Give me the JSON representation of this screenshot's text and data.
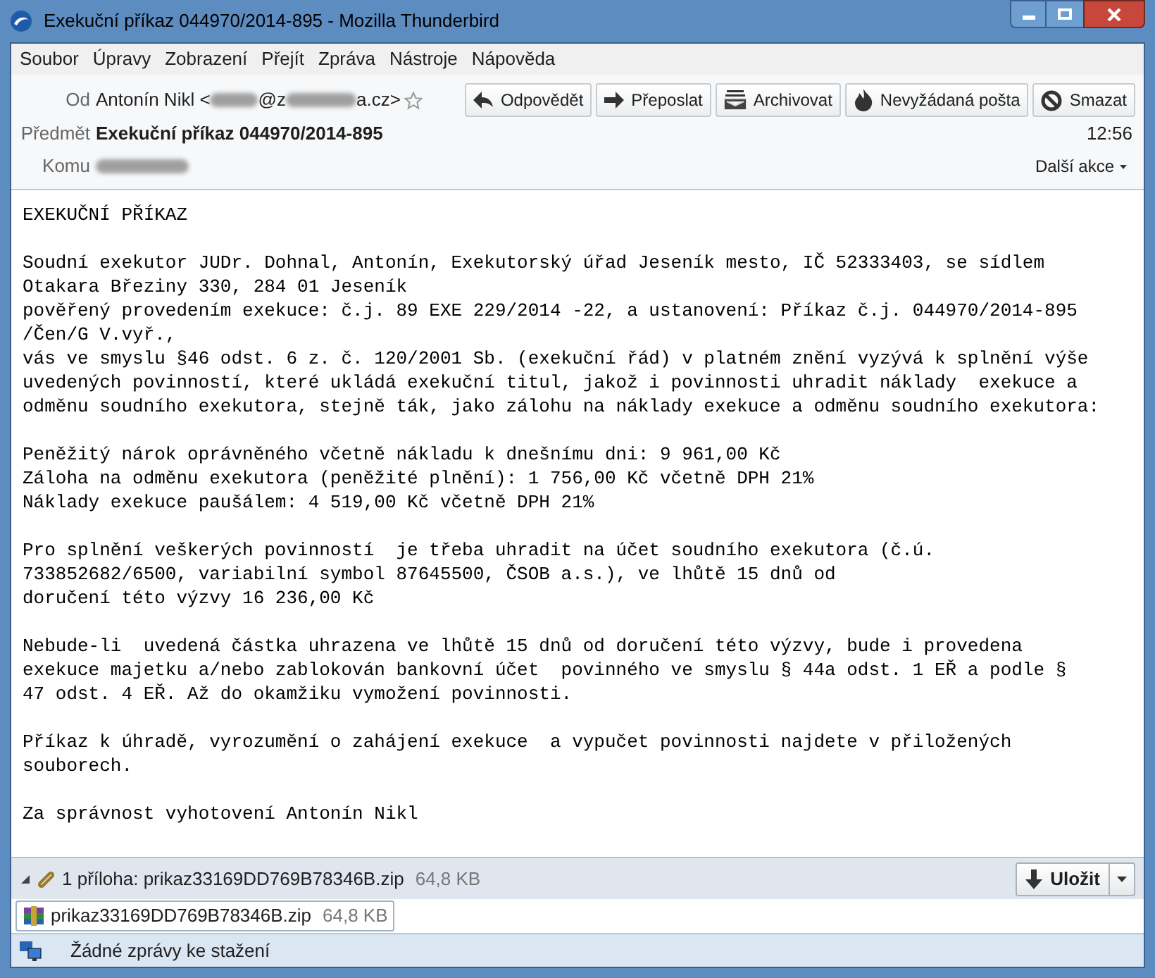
{
  "window": {
    "title": "Exekuční příkaz 044970/2014-895 - Mozilla Thunderbird"
  },
  "menu": [
    {
      "label": "Soubor"
    },
    {
      "label": "Úpravy"
    },
    {
      "label": "Zobrazení"
    },
    {
      "label": "Přejít"
    },
    {
      "label": "Zpráva"
    },
    {
      "label": "Nástroje"
    },
    {
      "label": "Nápověda"
    }
  ],
  "header": {
    "from_label": "Od",
    "from_name": "Antonín Nikl <",
    "from_at": "@z",
    "from_end": "a.cz>",
    "subject_label": "Předmět",
    "subject": "Exekuční příkaz 044970/2014-895",
    "to_label": "Komu",
    "time": "12:56",
    "more_actions": "Další akce"
  },
  "actions": [
    {
      "kind": "reply",
      "label": "Odpovědět"
    },
    {
      "kind": "forward",
      "label": "Přeposlat"
    },
    {
      "kind": "archive",
      "label": "Archivovat"
    },
    {
      "kind": "junk",
      "label": "Nevyžádaná pošta"
    },
    {
      "kind": "delete",
      "label": "Smazat"
    }
  ],
  "body": [
    [
      "EXEKUČNÍ PŘÍKAZ"
    ],
    [
      "Soudní exekutor JUDr. Dohnal, Antonín, Exekutorský úřad Jeseník mesto, IČ 52333403, se sídlem",
      "Otakara Březiny 330, 284 01 Jeseník",
      "pověřený provedením exekuce: č.j. 89 EXE 229/2014 -22, a ustanovení: Příkaz č.j. 044970/2014-895",
      "/Čen/G V.vyř.,",
      "vás ve smyslu §46 odst. 6 z. č. 120/2001 Sb. (exekuční řád) v platném znění vyzývá k splnění výše",
      "uvedených povinností, které ukládá exekuční titul, jakož i povinnosti uhradit náklady  exekuce a",
      "odměnu soudního exekutora, stejně ták, jako zálohu na náklady exekuce a odměnu soudního exekutora:"
    ],
    [
      "Peněžitý nárok oprávněného včetně nákladu k dnešnímu dni: 9 961,00 Kč",
      "Záloha na odměnu exekutora (peněžité plnění): 1 756,00 Kč včetně DPH 21%",
      "Náklady exekuce paušálem: 4 519,00 Kč včetně DPH 21%"
    ],
    [
      "Pro splnění veškerých povinností  je třeba uhradit na účet soudního exekutora (č.ú.",
      "733852682/6500, variabilní symbol 87645500, ČSOB a.s.), ve lhůtě 15 dnů od",
      "doručení této výzvy 16 236,00 Kč"
    ],
    [
      "Nebude-li  uvedená částka uhrazena ve lhůtě 15 dnů od doručení této výzvy, bude i provedena",
      "exekuce majetku a/nebo zablokován bankovní účet  povinného ve smyslu § 44a odst. 1 EŘ a podle §",
      "47 odst. 4 EŘ. Až do okamžiku vymožení povinnosti."
    ],
    [
      "Příkaz k úhradě, vyrozumění o zahájení exekuce  a vypučet povinnosti najdete v přiložených",
      "souborech."
    ],
    [
      "Za správnost vyhotovení Antonín Nikl"
    ]
  ],
  "attachments_bar": {
    "expanded": true,
    "summary": "1 příloha: prikaz33169DD769B78346B.zip",
    "size": "64,8 KB",
    "save": "Uložit"
  },
  "attachments": [
    {
      "name": "prikaz33169DD769B78346B.zip",
      "size": "64,8 KB"
    }
  ],
  "status_bar": {
    "text": "Žádné zprávy ke stažení"
  }
}
